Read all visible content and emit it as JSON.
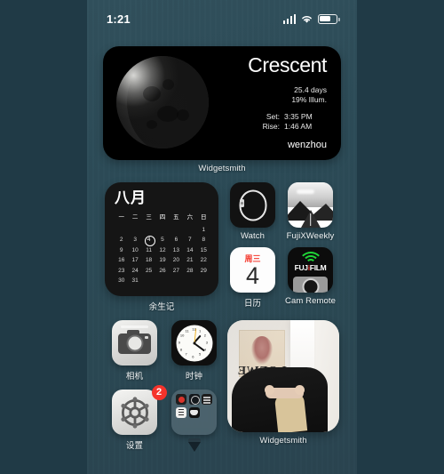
{
  "status_bar": {
    "time": "1:21",
    "signal_icon": "cellular-signal-icon",
    "wifi_icon": "wifi-icon",
    "battery_icon": "battery-icon"
  },
  "moon_widget": {
    "phase": "Crescent",
    "age": "25.4 days",
    "illumination": "19% Illum.",
    "set_label": "Set:",
    "set_time": "3:35 PM",
    "rise_label": "Rise:",
    "rise_time": "1:46 AM",
    "location": "wenzhou",
    "app_label": "Widgetsmith"
  },
  "calendar_widget": {
    "month": "八月",
    "weekdays": [
      "一",
      "二",
      "三",
      "四",
      "五",
      "六",
      "日"
    ],
    "leading_blanks": 6,
    "days": [
      1,
      2,
      3,
      4,
      5,
      6,
      7,
      8,
      9,
      10,
      11,
      12,
      13,
      14,
      15,
      16,
      17,
      18,
      19,
      20,
      21,
      22,
      23,
      24,
      25,
      26,
      27,
      28,
      29,
      30,
      31
    ],
    "today": 4,
    "app_label": "余生记"
  },
  "apps_right": [
    {
      "name": "Watch",
      "label": "Watch",
      "icon": "watch-icon"
    },
    {
      "name": "FujiXWeekly",
      "label": "FujiXWeekly",
      "icon": "fujixweekly-icon"
    },
    {
      "name": "Calendar",
      "label": "日历",
      "icon": "calendar-app-icon",
      "weekday": "周三",
      "day": "4"
    },
    {
      "name": "CamRemote",
      "label": "Cam Remote",
      "icon": "fujifilm-cam-remote-icon",
      "brand_1": "FUJ",
      "brand_i": "i",
      "brand_2": "FILM"
    }
  ],
  "apps_bottom": [
    {
      "name": "Camera",
      "label": "相机",
      "icon": "camera-icon"
    },
    {
      "name": "Clock",
      "label": "时钟",
      "icon": "clock-icon"
    },
    {
      "name": "Settings",
      "label": "设置",
      "icon": "settings-gear-icon",
      "badge": "2"
    },
    {
      "name": "Folder",
      "label": "",
      "icon": "folder-icon"
    }
  ],
  "photo_widget": {
    "poster_text": "LOEWE",
    "app_label": "Widgetsmith"
  },
  "colors": {
    "wallpaper": "#2c4b57",
    "widget_bg": "#000000",
    "badge_red": "#f5332b",
    "accent_green": "#1fd637",
    "fuji_red": "#e8322c",
    "label_text": "#f2f5f6"
  }
}
